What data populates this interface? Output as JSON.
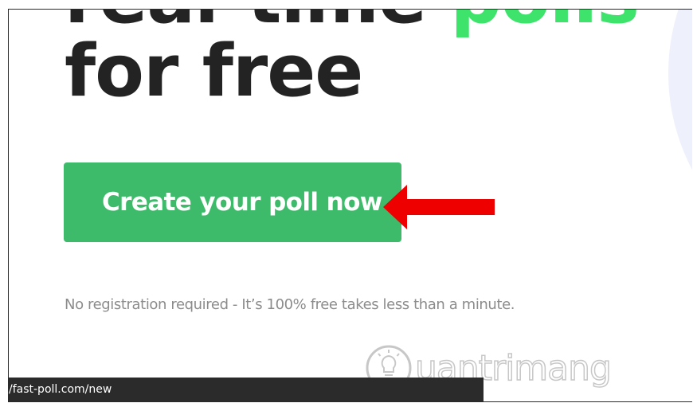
{
  "hero": {
    "headline_partial_line": "real-time ",
    "headline_accent": "polls",
    "headline_line2": "for free"
  },
  "cta": {
    "label": "Create your poll now"
  },
  "subnote": "No registration required - It’s 100% free takes less than a minute.",
  "status_bar": {
    "url": "/fast-poll.com/new"
  },
  "watermark": {
    "text": "uantrimang"
  },
  "colors": {
    "accent_green": "#3ee36c",
    "button_green": "#3dbb6a",
    "arrow_red": "#ee0000",
    "headline": "#232323",
    "subnote": "#8c8c8c",
    "status_bar_bg": "#2b2b2b"
  },
  "icons": {
    "annotation_arrow": "red-left-arrow-icon",
    "watermark_logo": "lightbulb-logo-icon"
  }
}
